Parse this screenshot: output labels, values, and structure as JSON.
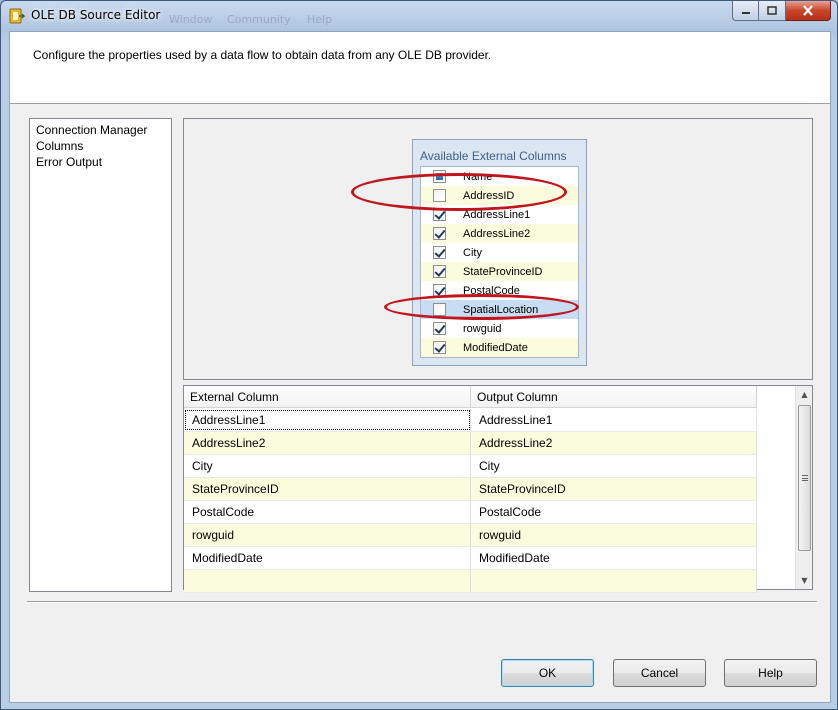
{
  "window": {
    "title": "OLE DB Source Editor",
    "ghost_menu": [
      "Window",
      "Community",
      "Help"
    ]
  },
  "header": {
    "description": "Configure the properties used by a data flow to obtain data from any OLE DB provider."
  },
  "nav": {
    "items": [
      {
        "label": "Connection Manager"
      },
      {
        "label": "Columns"
      },
      {
        "label": "Error Output"
      }
    ]
  },
  "available_columns": {
    "header": "Available External Columns",
    "items": [
      {
        "label": "Name",
        "state": "indeterminate"
      },
      {
        "label": "AddressID",
        "state": "unchecked"
      },
      {
        "label": "AddressLine1",
        "state": "checked"
      },
      {
        "label": "AddressLine2",
        "state": "checked"
      },
      {
        "label": "City",
        "state": "checked"
      },
      {
        "label": "StateProvinceID",
        "state": "checked"
      },
      {
        "label": "PostalCode",
        "state": "checked"
      },
      {
        "label": "SpatialLocation",
        "state": "unchecked",
        "selected": true
      },
      {
        "label": "rowguid",
        "state": "checked"
      },
      {
        "label": "ModifiedDate",
        "state": "checked"
      }
    ]
  },
  "grid": {
    "headers": [
      "External Column",
      "Output Column"
    ],
    "rows": [
      [
        "AddressLine1",
        "AddressLine1"
      ],
      [
        "AddressLine2",
        "AddressLine2"
      ],
      [
        "City",
        "City"
      ],
      [
        "StateProvinceID",
        "StateProvinceID"
      ],
      [
        "PostalCode",
        "PostalCode"
      ],
      [
        "rowguid",
        "rowguid"
      ],
      [
        "ModifiedDate",
        "ModifiedDate"
      ],
      [
        "",
        ""
      ]
    ]
  },
  "buttons": {
    "ok": "OK",
    "cancel": "Cancel",
    "help": "Help"
  },
  "colors": {
    "annotation": "#c0161c",
    "alt_row": "#fbfbde",
    "selected_row": "#c8dcf4"
  }
}
